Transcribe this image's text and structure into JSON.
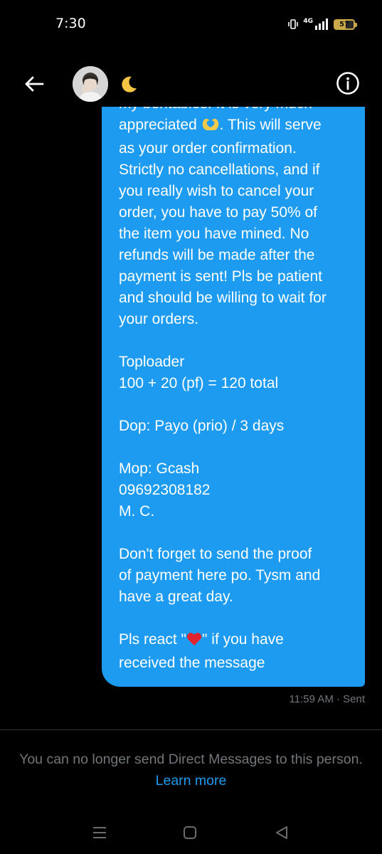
{
  "status_bar": {
    "time": "7:30",
    "network": "4G",
    "battery_level": "57",
    "battery_fraction": 0.57,
    "battery_color": "#c9a94a"
  },
  "header": {
    "back_icon": "arrow-left-icon",
    "contact_name_emoji": "🌙",
    "info_icon": "info-circle-icon"
  },
  "message": {
    "color": "#1d9bf0",
    "lines": [
      "my bentables! It is very much",
      "appreciated",
      ". This will serve",
      "as your order confirmation.",
      "Strictly no cancellations, and if",
      "you really wish to cancel your",
      "order, you have to pay 50% of",
      "the item you have mined. No",
      "refunds will be made after the",
      "payment is sent! Pls be patient",
      "and should be willing to wait for",
      "your orders.",
      "Toploader",
      "100 + 20 (pf) = 120 total",
      "Dop: Payo (prio) / 3 days",
      "Mop: Gcash",
      "09692308182",
      "M. C.",
      "Don't forget to send the proof",
      "of payment here po. Tysm and",
      "have a great day.",
      "Pls react \"",
      "\" if you have",
      "received the message"
    ],
    "timestamp": "11:59 AM · Sent"
  },
  "footer": {
    "notice": "You can no longer send Direct Messages to this person.",
    "learn_more": "Learn more"
  },
  "nav_bar": {
    "recents_icon": "recents-menu-icon",
    "home_icon": "home-square-icon",
    "back_icon": "back-triangle-icon"
  }
}
